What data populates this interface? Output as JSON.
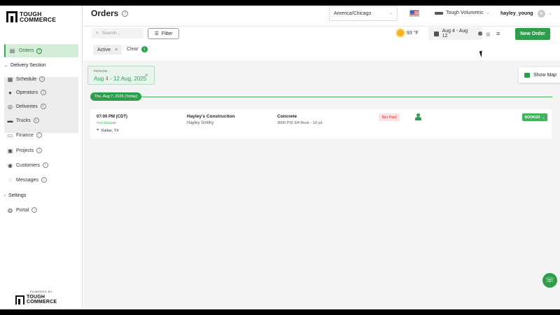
{
  "brand": {
    "logo_line1": "TOUGH",
    "logo_line2": "COMMERCE",
    "powered_by": "POWERED BY"
  },
  "header": {
    "title": "Orders",
    "timezone": "America/Chicago",
    "company": "Tough Volumetric",
    "username": "hayley_young",
    "avatar_initials": "H"
  },
  "sidebar": {
    "orders": "Orders",
    "delivery_section": "Delivery Section",
    "schedule": "Schedule",
    "operators": "Operators",
    "deliveries": "Deliveries",
    "trucks": "Trucks",
    "finance": "Finance",
    "projects": "Projects",
    "customers": "Customers",
    "messages": "Messages",
    "settings": "Settings",
    "portal": "Portal",
    "icons": {
      "orders": "orders-icon",
      "schedule": "schedule-icon",
      "operators": "person-icon",
      "deliveries": "pin-icon",
      "trucks": "truck-icon",
      "finance": "document-icon",
      "projects": "projects-icon",
      "customers": "customers-icon",
      "messages": "message-icon",
      "portal": "globe-icon"
    }
  },
  "toolbar": {
    "search_placeholder": "Search...",
    "filter_label": "Filter",
    "temperature": "93 °F",
    "date_range": "Aug 4 - Aug 12",
    "new_order_label": "New Order"
  },
  "filters": {
    "active_chip": "Active",
    "clear_label": "Clear",
    "clear_count": "1"
  },
  "period": {
    "label": "PERIOD",
    "value": "Aug 4 - 12 Aug, 2025"
  },
  "map_button": "Show Map",
  "day_label": "Thu, Aug 7, 2025 (Today)",
  "orders": [
    {
      "time": "07:00 PM (CDT)",
      "id": "TVC-0011168",
      "location": "Dallas, TX",
      "customer": "Hayley's Construction",
      "contact": "Hayley Smithy",
      "material": "Concrete",
      "spec": "3500 PSI 3/4 Rock - 10 yd",
      "payment": "Not Paid",
      "status": "BOOKED"
    }
  ],
  "colors": {
    "accent": "#2e9e4d",
    "active_bg": "#d4eed9",
    "not_paid": "#d32f2f"
  }
}
